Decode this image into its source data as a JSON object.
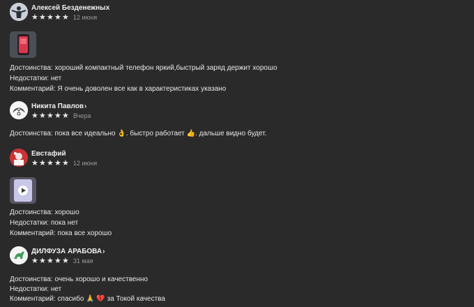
{
  "reviews": [
    {
      "author": "Алексей Безденежных",
      "has_chevron": false,
      "rating": 5,
      "date": "12 июня",
      "lines": [
        "Достоинства: хороший компактный телефон яркий,быстрый заряд держит хорошо",
        "Недостатки: нет",
        "Комментарий: Я очень доволен все как в характеристиках указано"
      ]
    },
    {
      "author": "Никита Павлов",
      "has_chevron": true,
      "rating": 5,
      "date": "Вчера",
      "lines": [
        "Достоинства: пока все идеально 👌. быстро работает 👍. дальше видно будет."
      ]
    },
    {
      "author": "Евстафий",
      "has_chevron": false,
      "rating": 5,
      "date": "12 июня",
      "lines": [
        "Достоинства: хорошо",
        "Недостатки: пока нет",
        "Комментарий: пока все хорошо"
      ]
    },
    {
      "author": "ДИЛФУЗА АРАБОВА",
      "has_chevron": true,
      "rating": 5,
      "date": "31 мая",
      "lines": [
        "Достоинства: очень хорошо и качественно",
        "Недостатки: нет",
        "Комментарий: спасибо 🙏 💔 за Токой качества"
      ]
    }
  ],
  "icons": {
    "star": "★",
    "chevron": "›"
  }
}
